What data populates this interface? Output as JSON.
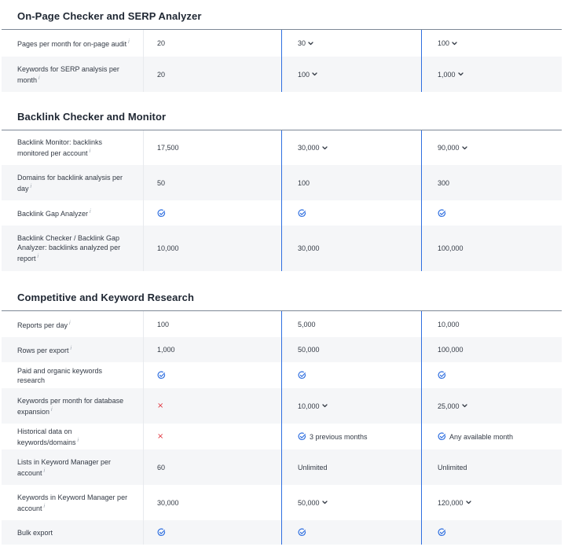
{
  "sections": [
    {
      "title": "On-Page Checker and SERP Analyzer",
      "rows": [
        {
          "label": "Pages per month for on-page audit",
          "info": "i",
          "c1": {
            "text": "20"
          },
          "c2": {
            "text": "30",
            "dropdown": true
          },
          "c3": {
            "text": "100",
            "dropdown": true
          }
        },
        {
          "label": "Keywords for SERP analysis per month",
          "info": "i",
          "c1": {
            "text": "20"
          },
          "c2": {
            "text": "100",
            "dropdown": true
          },
          "c3": {
            "text": "1,000",
            "dropdown": true
          }
        }
      ]
    },
    {
      "title": "Backlink Checker and Monitor",
      "rows": [
        {
          "label": "Backlink Monitor: backlinks monitored per account",
          "info": "i",
          "c1": {
            "text": "17,500"
          },
          "c2": {
            "text": "30,000",
            "dropdown": true
          },
          "c3": {
            "text": "90,000",
            "dropdown": true
          }
        },
        {
          "label": "Domains for backlink analysis per day",
          "info": "i",
          "c1": {
            "text": "50"
          },
          "c2": {
            "text": "100"
          },
          "c3": {
            "text": "300"
          }
        },
        {
          "label": "Backlink Gap Analyzer",
          "info": "i",
          "c1": {
            "check": true
          },
          "c2": {
            "check": true
          },
          "c3": {
            "check": true
          }
        },
        {
          "label": "Backlink Checker / Backlink Gap Analyzer: backlinks analyzed per report",
          "info": "i",
          "c1": {
            "text": "10,000"
          },
          "c2": {
            "text": "30,000"
          },
          "c3": {
            "text": "100,000"
          }
        }
      ]
    },
    {
      "title": "Competitive and Keyword Research",
      "rows": [
        {
          "label": "Reports per day",
          "info": "i",
          "c1": {
            "text": "100"
          },
          "c2": {
            "text": "5,000"
          },
          "c3": {
            "text": "10,000"
          }
        },
        {
          "label": "Rows per export",
          "info": "i",
          "c1": {
            "text": "1,000"
          },
          "c2": {
            "text": "50,000"
          },
          "c3": {
            "text": "100,000"
          }
        },
        {
          "label": "Paid and organic keywords research",
          "info": "",
          "c1": {
            "check": true
          },
          "c2": {
            "check": true
          },
          "c3": {
            "check": true
          }
        },
        {
          "label": "Keywords per month for database expansion",
          "info": "i",
          "c1": {
            "cross": "×"
          },
          "c2": {
            "text": "10,000",
            "dropdown": true
          },
          "c3": {
            "text": "25,000",
            "dropdown": true
          }
        },
        {
          "label": "Historical data on keywords/domains",
          "info": "i",
          "c1": {
            "cross": "×"
          },
          "c2": {
            "check": true,
            "text": "3 previous months"
          },
          "c3": {
            "check": true,
            "text": "Any available month"
          }
        },
        {
          "label": "Lists in Keyword Manager per account",
          "info": "i",
          "c1": {
            "text": "60"
          },
          "c2": {
            "text": "Unlimited"
          },
          "c3": {
            "text": "Unlimited"
          }
        },
        {
          "label": "Keywords in Keyword Manager per account",
          "info": "i",
          "c1": {
            "text": "30,000"
          },
          "c2": {
            "text": "50,000",
            "dropdown": true
          },
          "c3": {
            "text": "120,000",
            "dropdown": true
          }
        },
        {
          "label": "Bulk export",
          "info": "",
          "c1": {
            "check": true
          },
          "c2": {
            "check": true
          },
          "c3": {
            "check": true
          }
        }
      ]
    }
  ],
  "colors": {
    "accent": "#2f6fe0",
    "cross": "#e0323c",
    "alt_row": "#f5f6f8"
  }
}
